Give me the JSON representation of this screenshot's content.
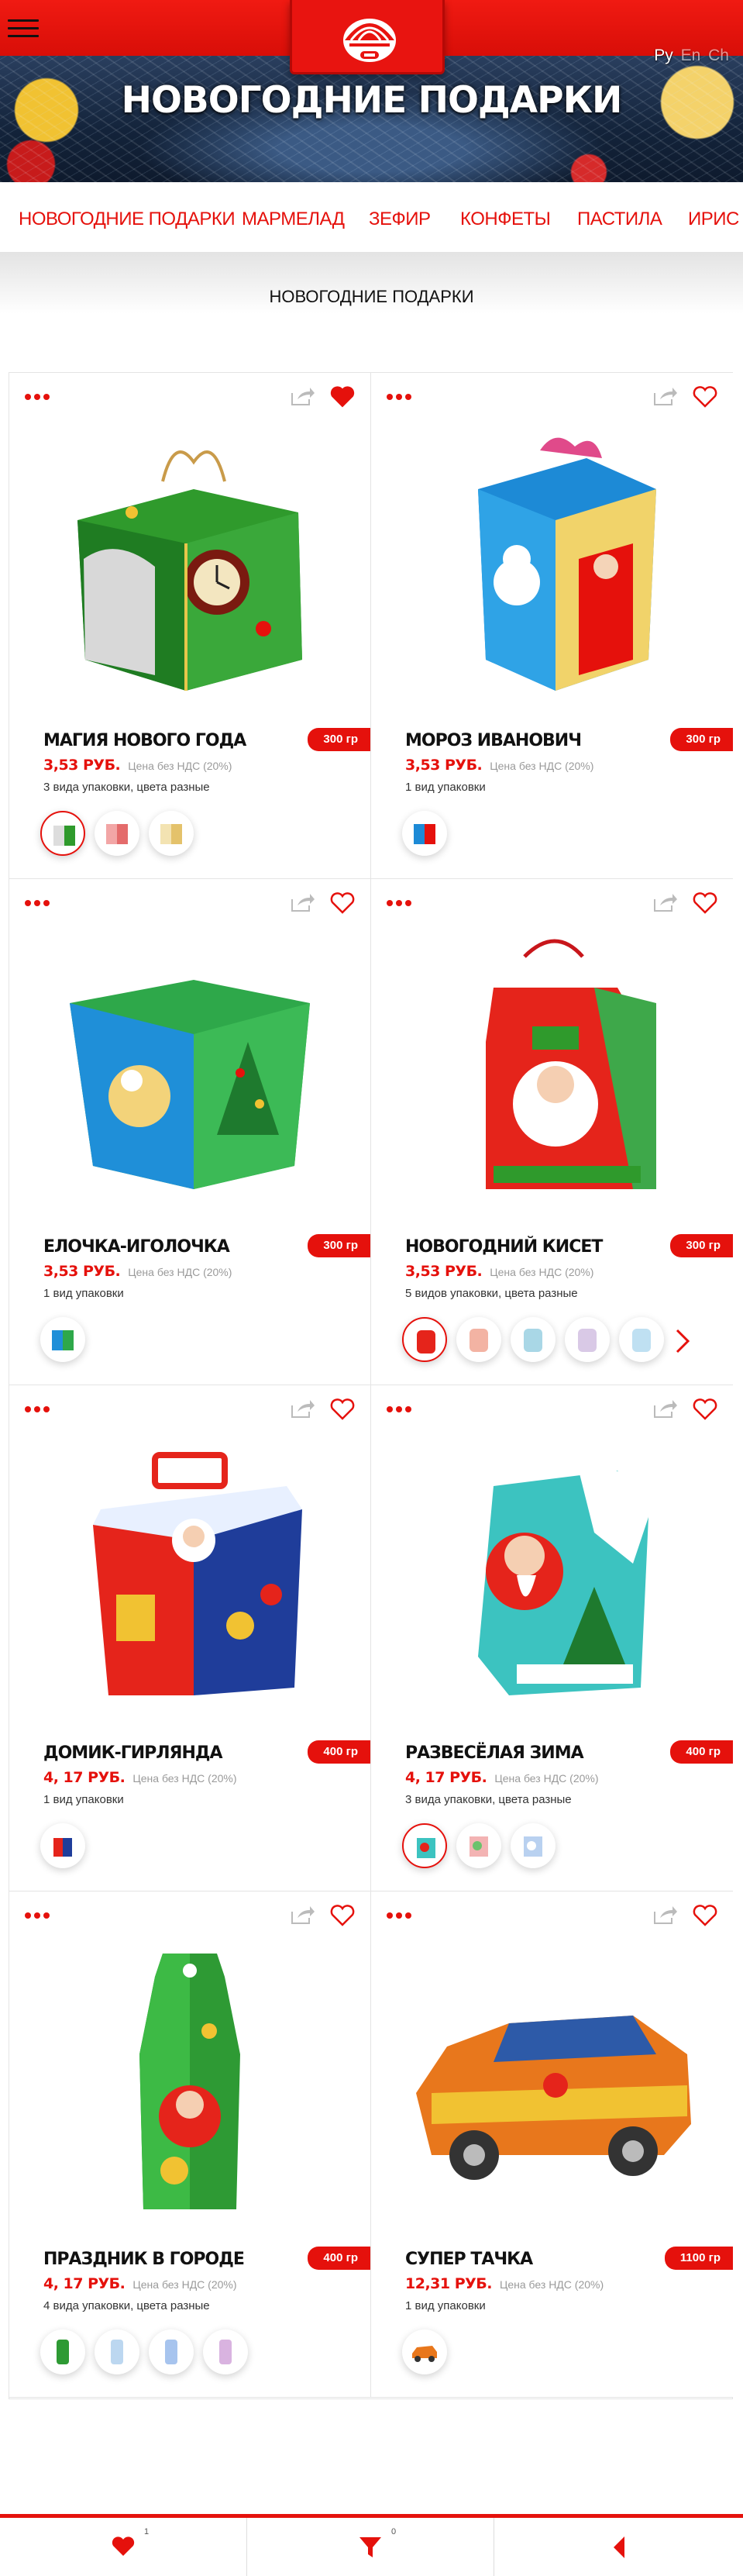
{
  "header": {
    "title": "НОВОГОДНИЕ ПОДАРКИ",
    "languages": [
      "Ру",
      "En",
      "Ch"
    ]
  },
  "categories": [
    "НОВОГОДНИЕ ПОДАРКИ",
    "МАРМЕЛАД",
    "ЗЕФИР",
    "КОНФЕТЫ",
    "ПАСТИЛА",
    "ИРИС"
  ],
  "section_title": "НОВОГОДНИЕ ПОДАРКИ",
  "vat_note": "Цена без НДС (20%)",
  "products": [
    {
      "name": "МАГИЯ НОВОГО ГОДА",
      "weight": "300 гр",
      "price": "3,53 РУБ.",
      "packaging": "3 вида упаковки, цвета разные",
      "favorite": true
    },
    {
      "name": "МОРОЗ ИВАНОВИЧ",
      "weight": "300 гр",
      "price": "3,53 РУБ.",
      "packaging": "1 вид упаковки",
      "favorite": false
    },
    {
      "name": "ЕЛОЧКА-ИГОЛОЧКА",
      "weight": "300 гр",
      "price": "3,53 РУБ.",
      "packaging": "1 вид упаковки",
      "favorite": false
    },
    {
      "name": "НОВОГОДНИЙ КИСЕТ",
      "weight": "300 гр",
      "price": "3,53 РУБ.",
      "packaging": "5 видов упаковки, цвета разные",
      "favorite": false
    },
    {
      "name": "ДОМИК-ГИРЛЯНДА",
      "weight": "400 гр",
      "price": "4, 17 РУБ.",
      "packaging": "1 вид упаковки",
      "favorite": false
    },
    {
      "name": "РАЗВЕСЁЛАЯ ЗИМА",
      "weight": "400 гр",
      "price": "4, 17 РУБ.",
      "packaging": "3 вида упаковки, цвета разные",
      "favorite": false
    },
    {
      "name": "ПРАЗДНИК В ГОРОДЕ",
      "weight": "400 гр",
      "price": "4, 17 РУБ.",
      "packaging": "4 вида упаковки, цвета разные",
      "favorite": false
    },
    {
      "name": "СУПЕР ТАЧКА",
      "weight": "1100 гр",
      "price": "12,31 РУБ.",
      "packaging": "1 вид упаковки",
      "favorite": false
    }
  ],
  "bottom_bar": {
    "favorites_count": "1",
    "filter_count": "0"
  },
  "colors": {
    "brand_red": "#e5110c",
    "text_dark": "#111111",
    "muted_gray": "#9a9a9a"
  },
  "icons": [
    "menu-icon",
    "dots-icon",
    "share-icon",
    "heart-icon",
    "filter-icon",
    "back-icon",
    "chevron-right-icon"
  ]
}
